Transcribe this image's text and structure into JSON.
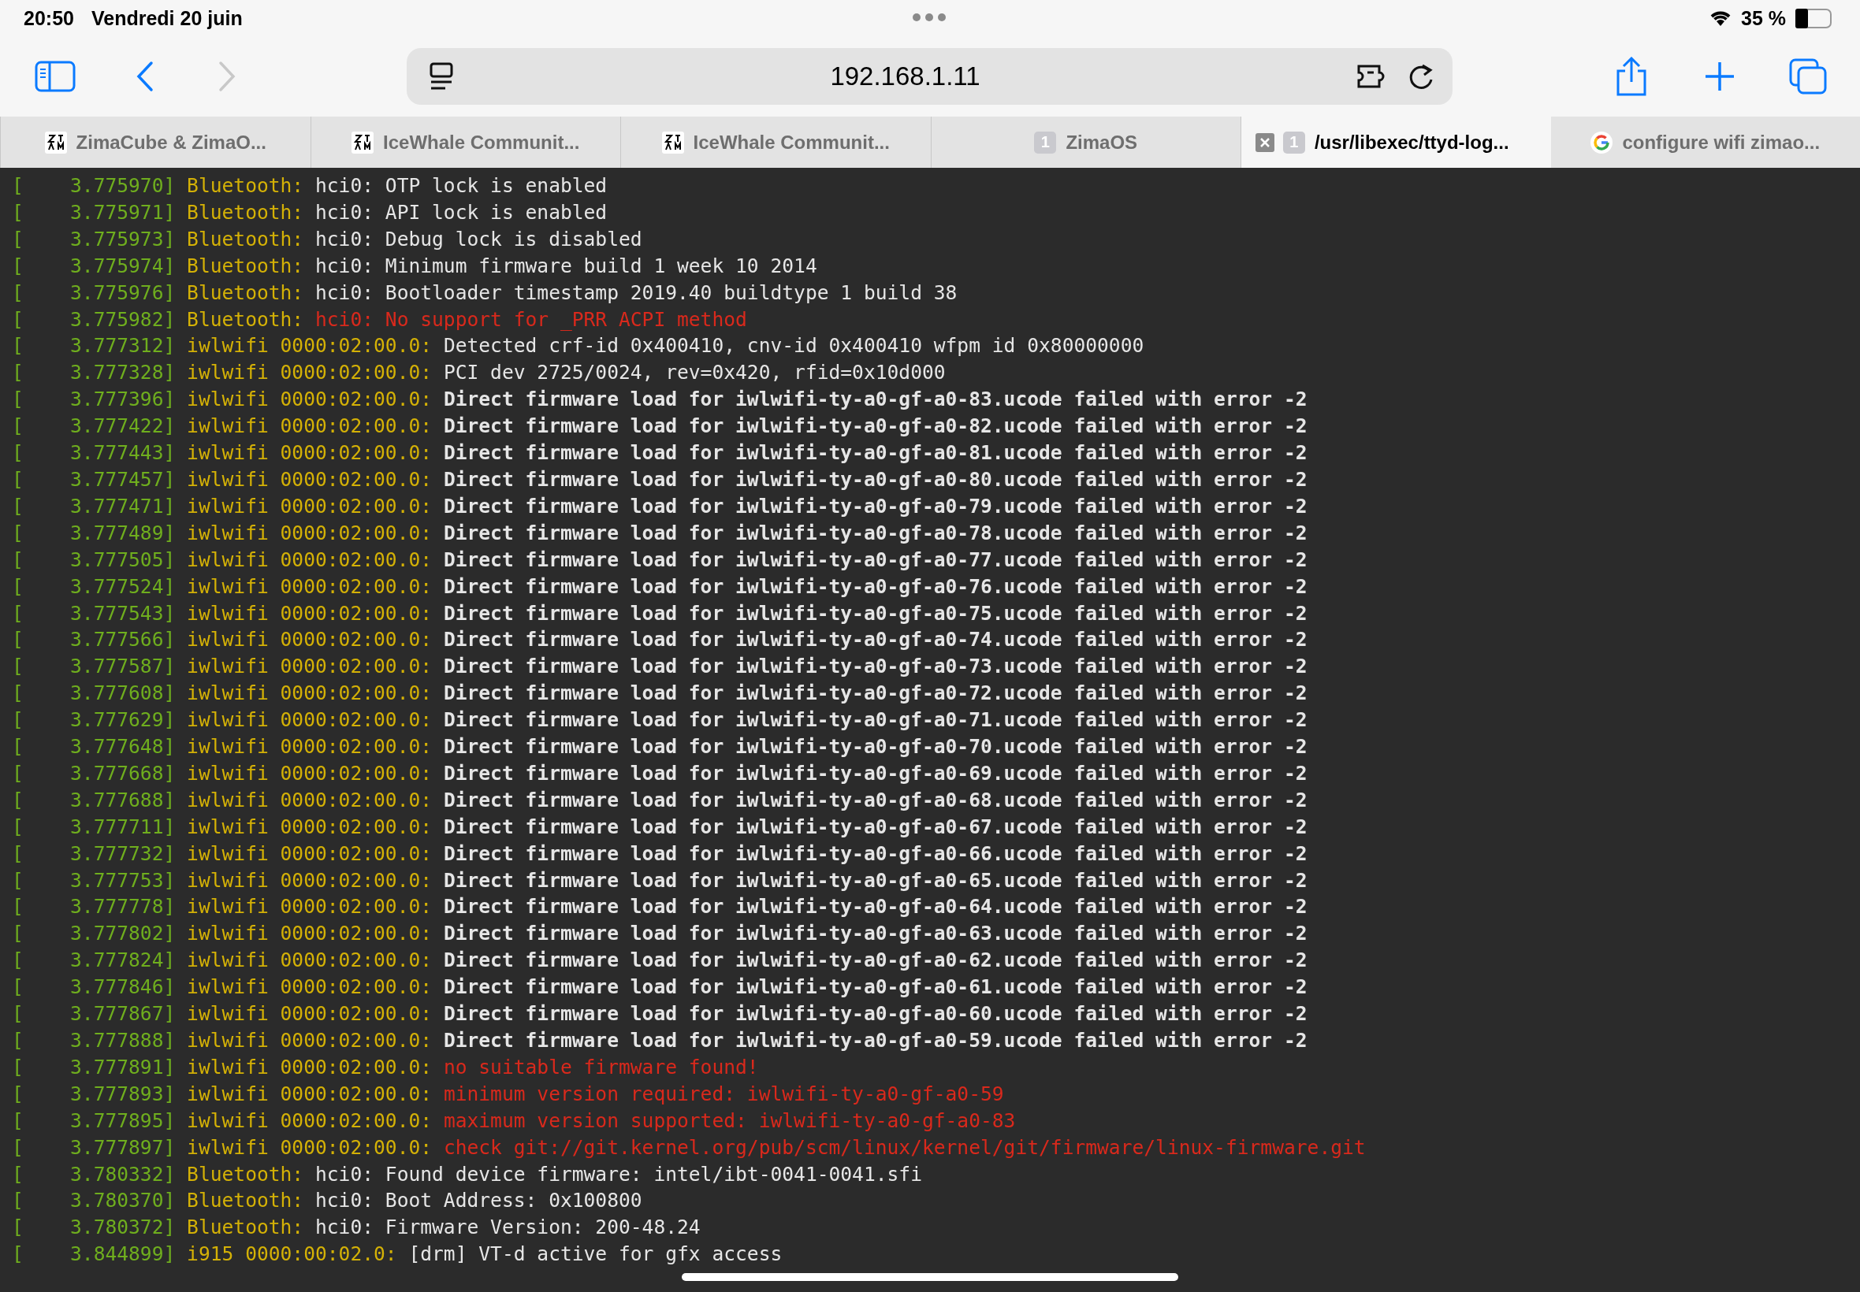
{
  "status_bar": {
    "time": "20:50",
    "date": "Vendredi 20 juin",
    "battery_text": "35 %",
    "battery": {
      "level": 0.35
    }
  },
  "toolbar": {
    "url": "192.168.1.11",
    "forward_disabled": true
  },
  "tabs": [
    {
      "label": "ZimaCube & ZimaO...",
      "kind": "zima",
      "selected": false
    },
    {
      "label": "IceWhale Communit...",
      "kind": "zima",
      "selected": false
    },
    {
      "label": "IceWhale Communit...",
      "kind": "zima",
      "selected": false
    },
    {
      "label": "ZimaOS",
      "kind": "count",
      "count": "1",
      "selected": false
    },
    {
      "label": "/usr/libexec/ttyd-log...",
      "kind": "count",
      "count": "1",
      "selected": true
    },
    {
      "label": "configure wifi zimao...",
      "kind": "google",
      "selected": false
    }
  ],
  "terminal": {
    "lines": [
      {
        "time": "[    3.775970]",
        "source": "Bluetooth:",
        "message": "hci0: OTP lock is enabled",
        "kind": "normal"
      },
      {
        "time": "[    3.775971]",
        "source": "Bluetooth:",
        "message": "hci0: API lock is enabled",
        "kind": "normal"
      },
      {
        "time": "[    3.775973]",
        "source": "Bluetooth:",
        "message": "hci0: Debug lock is disabled",
        "kind": "normal"
      },
      {
        "time": "[    3.775974]",
        "source": "Bluetooth:",
        "message": "hci0: Minimum firmware build 1 week 10 2014",
        "kind": "normal"
      },
      {
        "time": "[    3.775976]",
        "source": "Bluetooth:",
        "message": "hci0: Bootloader timestamp 2019.40 buildtype 1 build 38",
        "kind": "normal"
      },
      {
        "time": "[    3.775982]",
        "source": "Bluetooth:",
        "message": "hci0: No support for _PRR ACPI method",
        "kind": "error"
      },
      {
        "time": "[    3.777312]",
        "source": "iwlwifi 0000:02:00.0:",
        "message": "Detected crf-id 0x400410, cnv-id 0x400410 wfpm id 0x80000000",
        "kind": "normal"
      },
      {
        "time": "[    3.777328]",
        "source": "iwlwifi 0000:02:00.0:",
        "message": "PCI dev 2725/0024, rev=0x420, rfid=0x10d000",
        "kind": "normal"
      },
      {
        "time": "[    3.777396]",
        "source": "iwlwifi 0000:02:00.0:",
        "message": "Direct firmware load for iwlwifi-ty-a0-gf-a0-83.ucode failed with error -2",
        "kind": "warning"
      },
      {
        "time": "[    3.777422]",
        "source": "iwlwifi 0000:02:00.0:",
        "message": "Direct firmware load for iwlwifi-ty-a0-gf-a0-82.ucode failed with error -2",
        "kind": "warning"
      },
      {
        "time": "[    3.777443]",
        "source": "iwlwifi 0000:02:00.0:",
        "message": "Direct firmware load for iwlwifi-ty-a0-gf-a0-81.ucode failed with error -2",
        "kind": "warning"
      },
      {
        "time": "[    3.777457]",
        "source": "iwlwifi 0000:02:00.0:",
        "message": "Direct firmware load for iwlwifi-ty-a0-gf-a0-80.ucode failed with error -2",
        "kind": "warning"
      },
      {
        "time": "[    3.777471]",
        "source": "iwlwifi 0000:02:00.0:",
        "message": "Direct firmware load for iwlwifi-ty-a0-gf-a0-79.ucode failed with error -2",
        "kind": "warning"
      },
      {
        "time": "[    3.777489]",
        "source": "iwlwifi 0000:02:00.0:",
        "message": "Direct firmware load for iwlwifi-ty-a0-gf-a0-78.ucode failed with error -2",
        "kind": "warning"
      },
      {
        "time": "[    3.777505]",
        "source": "iwlwifi 0000:02:00.0:",
        "message": "Direct firmware load for iwlwifi-ty-a0-gf-a0-77.ucode failed with error -2",
        "kind": "warning"
      },
      {
        "time": "[    3.777524]",
        "source": "iwlwifi 0000:02:00.0:",
        "message": "Direct firmware load for iwlwifi-ty-a0-gf-a0-76.ucode failed with error -2",
        "kind": "warning"
      },
      {
        "time": "[    3.777543]",
        "source": "iwlwifi 0000:02:00.0:",
        "message": "Direct firmware load for iwlwifi-ty-a0-gf-a0-75.ucode failed with error -2",
        "kind": "warning"
      },
      {
        "time": "[    3.777566]",
        "source": "iwlwifi 0000:02:00.0:",
        "message": "Direct firmware load for iwlwifi-ty-a0-gf-a0-74.ucode failed with error -2",
        "kind": "warning"
      },
      {
        "time": "[    3.777587]",
        "source": "iwlwifi 0000:02:00.0:",
        "message": "Direct firmware load for iwlwifi-ty-a0-gf-a0-73.ucode failed with error -2",
        "kind": "warning"
      },
      {
        "time": "[    3.777608]",
        "source": "iwlwifi 0000:02:00.0:",
        "message": "Direct firmware load for iwlwifi-ty-a0-gf-a0-72.ucode failed with error -2",
        "kind": "warning"
      },
      {
        "time": "[    3.777629]",
        "source": "iwlwifi 0000:02:00.0:",
        "message": "Direct firmware load for iwlwifi-ty-a0-gf-a0-71.ucode failed with error -2",
        "kind": "warning"
      },
      {
        "time": "[    3.777648]",
        "source": "iwlwifi 0000:02:00.0:",
        "message": "Direct firmware load for iwlwifi-ty-a0-gf-a0-70.ucode failed with error -2",
        "kind": "warning"
      },
      {
        "time": "[    3.777668]",
        "source": "iwlwifi 0000:02:00.0:",
        "message": "Direct firmware load for iwlwifi-ty-a0-gf-a0-69.ucode failed with error -2",
        "kind": "warning"
      },
      {
        "time": "[    3.777688]",
        "source": "iwlwifi 0000:02:00.0:",
        "message": "Direct firmware load for iwlwifi-ty-a0-gf-a0-68.ucode failed with error -2",
        "kind": "warning"
      },
      {
        "time": "[    3.777711]",
        "source": "iwlwifi 0000:02:00.0:",
        "message": "Direct firmware load for iwlwifi-ty-a0-gf-a0-67.ucode failed with error -2",
        "kind": "warning"
      },
      {
        "time": "[    3.777732]",
        "source": "iwlwifi 0000:02:00.0:",
        "message": "Direct firmware load for iwlwifi-ty-a0-gf-a0-66.ucode failed with error -2",
        "kind": "warning"
      },
      {
        "time": "[    3.777753]",
        "source": "iwlwifi 0000:02:00.0:",
        "message": "Direct firmware load for iwlwifi-ty-a0-gf-a0-65.ucode failed with error -2",
        "kind": "warning"
      },
      {
        "time": "[    3.777778]",
        "source": "iwlwifi 0000:02:00.0:",
        "message": "Direct firmware load for iwlwifi-ty-a0-gf-a0-64.ucode failed with error -2",
        "kind": "warning"
      },
      {
        "time": "[    3.777802]",
        "source": "iwlwifi 0000:02:00.0:",
        "message": "Direct firmware load for iwlwifi-ty-a0-gf-a0-63.ucode failed with error -2",
        "kind": "warning"
      },
      {
        "time": "[    3.777824]",
        "source": "iwlwifi 0000:02:00.0:",
        "message": "Direct firmware load for iwlwifi-ty-a0-gf-a0-62.ucode failed with error -2",
        "kind": "warning"
      },
      {
        "time": "[    3.777846]",
        "source": "iwlwifi 0000:02:00.0:",
        "message": "Direct firmware load for iwlwifi-ty-a0-gf-a0-61.ucode failed with error -2",
        "kind": "warning"
      },
      {
        "time": "[    3.777867]",
        "source": "iwlwifi 0000:02:00.0:",
        "message": "Direct firmware load for iwlwifi-ty-a0-gf-a0-60.ucode failed with error -2",
        "kind": "warning"
      },
      {
        "time": "[    3.777888]",
        "source": "iwlwifi 0000:02:00.0:",
        "message": "Direct firmware load for iwlwifi-ty-a0-gf-a0-59.ucode failed with error -2",
        "kind": "warning"
      },
      {
        "time": "[    3.777891]",
        "source": "iwlwifi 0000:02:00.0:",
        "message": "no suitable firmware found!",
        "kind": "error"
      },
      {
        "time": "[    3.777893]",
        "source": "iwlwifi 0000:02:00.0:",
        "message": "minimum version required: iwlwifi-ty-a0-gf-a0-59",
        "kind": "error"
      },
      {
        "time": "[    3.777895]",
        "source": "iwlwifi 0000:02:00.0:",
        "message": "maximum version supported: iwlwifi-ty-a0-gf-a0-83",
        "kind": "error"
      },
      {
        "time": "[    3.777897]",
        "source": "iwlwifi 0000:02:00.0:",
        "message": "check git://git.kernel.org/pub/scm/linux/kernel/git/firmware/linux-firmware.git",
        "kind": "error"
      },
      {
        "time": "[    3.780332]",
        "source": "Bluetooth:",
        "message": "hci0: Found device firmware: intel/ibt-0041-0041.sfi",
        "kind": "normal"
      },
      {
        "time": "[    3.780370]",
        "source": "Bluetooth:",
        "message": "hci0: Boot Address: 0x100800",
        "kind": "normal"
      },
      {
        "time": "[    3.780372]",
        "source": "Bluetooth:",
        "message": "hci0: Firmware Version: 200-48.24",
        "kind": "normal"
      },
      {
        "time": "[    3.844899]",
        "source": "i915 0000:00:02.0:",
        "message": "[drm] VT-d active for gfx access",
        "kind": "normal"
      }
    ]
  }
}
